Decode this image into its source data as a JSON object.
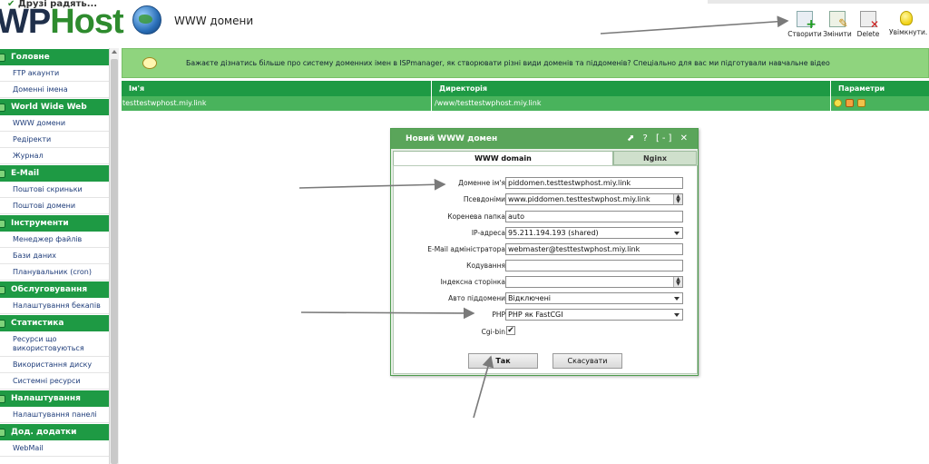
{
  "brand": {
    "tagline": "Друзі радять...",
    "logo_dark": "WP",
    "logo_green": "Host"
  },
  "header": {
    "title": "WWW домени",
    "toolbar": {
      "create": "Створити",
      "edit": "Змінити",
      "delete": "Delete",
      "enable": "Увімкнути."
    }
  },
  "sidebar": {
    "sections": [
      {
        "title": "Головне",
        "items": [
          "FTP акаунти",
          "Доменні імена"
        ]
      },
      {
        "title": "World Wide Web",
        "items": [
          "WWW домени",
          "Редіректи",
          "Журнал"
        ]
      },
      {
        "title": "E-Mail",
        "items": [
          "Поштові скриньки",
          "Поштові домени"
        ]
      },
      {
        "title": "Інструменти",
        "items": [
          "Менеджер файлів",
          "Бази даних",
          "Планувальник (cron)"
        ]
      },
      {
        "title": "Обслуговування",
        "items": [
          "Налаштування бекапів"
        ]
      },
      {
        "title": "Статистика",
        "items": [
          "Ресурси що використовуються",
          "Використання диску",
          "Системні ресурси"
        ]
      },
      {
        "title": "Налаштування",
        "items": [
          "Налаштування панелі"
        ]
      },
      {
        "title": "Дод. додатки",
        "items": [
          "WebMail"
        ]
      }
    ]
  },
  "banner": {
    "text": "Бажаєте дізнатись більше про систему доменних імен в ISPmanager, як створювати різні види доменів та піддоменів? Спеціально для вас ми підготували навчальне відео"
  },
  "table": {
    "columns": [
      "Ім'я",
      "Директорія",
      "Параметри"
    ],
    "rows": [
      {
        "name": "testtestwphost.miy.link",
        "dir": "/www/testtestwphost.miy.link"
      }
    ]
  },
  "dialog": {
    "title": "Новий WWW домен",
    "controls": "⬈ ? [-] ✕",
    "tabs": [
      "WWW domain",
      "Nginx"
    ],
    "fields": {
      "domain_label": "Доменне ім'я",
      "domain_value": "piddomen.testtestwphost.miy.link",
      "aliases_label": "Псевдоніми",
      "aliases_value": "www.piddomen.testtestwphost.miy.link",
      "root_label": "Коренева папка",
      "root_value": "auto",
      "ip_label": "IP-адреса",
      "ip_value": "95.211.194.193 (shared)",
      "email_label": "E-Mail адміністратора",
      "email_value": "webmaster@testtestwphost.miy.link",
      "charset_label": "Кодування",
      "charset_value": "",
      "index_label": "Індексна сторінка",
      "index_value": "",
      "autosub_label": "Авто піддомени",
      "autosub_value": "Відключені",
      "php_label": "PHP",
      "php_value": "PHP як FastCGI",
      "cgi_label": "Cgi-bin",
      "cgi_checked": "✔"
    },
    "buttons": {
      "ok": "Так",
      "cancel": "Скасувати"
    }
  },
  "colors": {
    "sidebar_header": "#1e9a44",
    "table_row_selected": "#49b35c",
    "banner": "#8fd47e",
    "dialog_title": "#5aa55a"
  }
}
